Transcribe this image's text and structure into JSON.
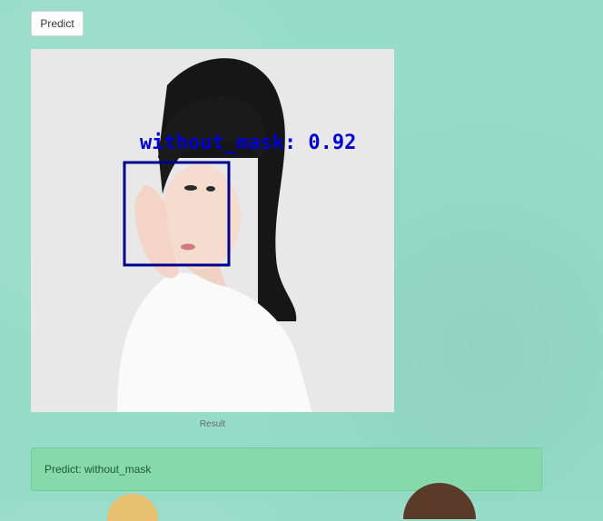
{
  "toolbar": {
    "predict_label": "Predict"
  },
  "result": {
    "detection_label": "without_mask: 0.92",
    "caption": "Result"
  },
  "alert": {
    "text": "Predict: without_mask"
  },
  "colors": {
    "background": "#96dcc8",
    "detection_box": "#00008b",
    "detection_text": "#0000cd",
    "alert_bg": "#86d9aa",
    "alert_text": "#1d5a3a"
  }
}
